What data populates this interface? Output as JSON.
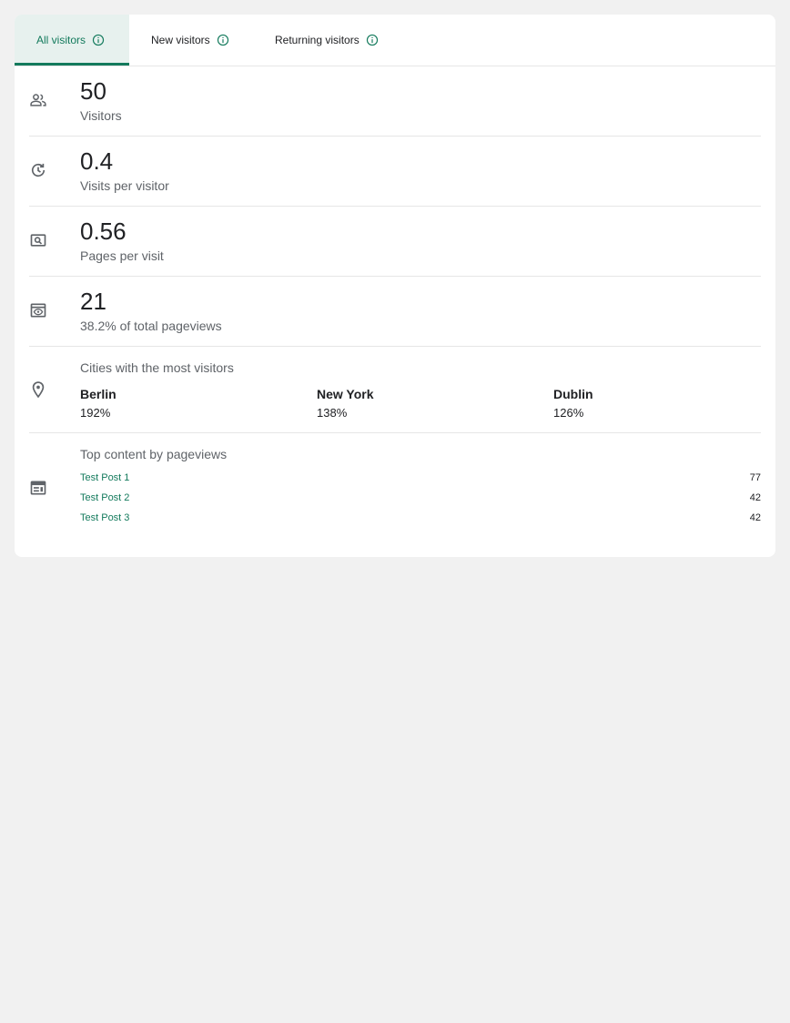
{
  "tabs": [
    {
      "label": "All visitors",
      "active": true
    },
    {
      "label": "New visitors",
      "active": false
    },
    {
      "label": "Returning visitors",
      "active": false
    }
  ],
  "metrics": {
    "visitors": {
      "value": "50",
      "label": "Visitors",
      "icon": "people-icon"
    },
    "visits_per_visitor": {
      "value": "0.4",
      "label": "Visits per visitor",
      "icon": "history-icon"
    },
    "pages_per_visit": {
      "value": "0.56",
      "label": "Pages per visit",
      "icon": "page-search-icon"
    },
    "pageviews": {
      "value": "21",
      "label": "38.2% of total pageviews",
      "icon": "eye-window-icon"
    }
  },
  "cities": {
    "title": "Cities with the most visitors",
    "icon": "location-pin-icon",
    "items": [
      {
        "name": "Berlin",
        "pct": "192%"
      },
      {
        "name": "New York",
        "pct": "138%"
      },
      {
        "name": "Dublin",
        "pct": "126%"
      }
    ]
  },
  "top_content": {
    "title": "Top content by pageviews",
    "icon": "web-page-icon",
    "items": [
      {
        "title": "Test Post 1",
        "count": "77"
      },
      {
        "title": "Test Post 2",
        "count": "42"
      },
      {
        "title": "Test Post 3",
        "count": "42"
      }
    ]
  },
  "colors": {
    "accent": "#137a5c",
    "active_tab_bg": "#e7f1ee",
    "page_bg": "#f1f1f1",
    "muted_text": "#5f6368",
    "icon": "#5f6368"
  }
}
